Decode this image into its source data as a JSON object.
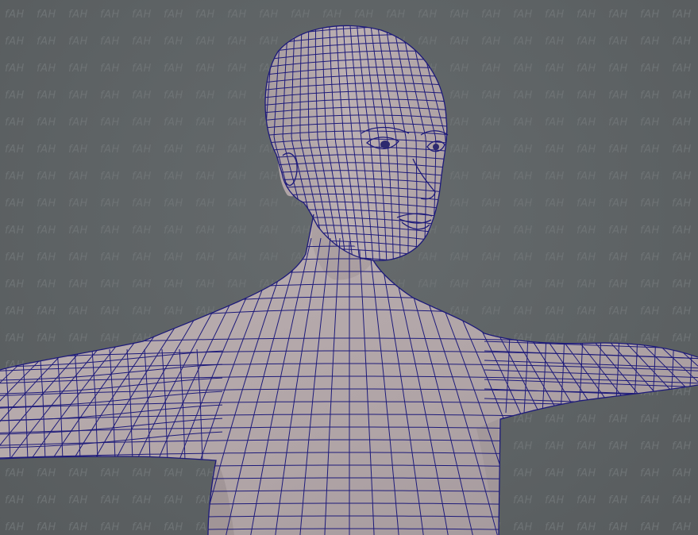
{
  "watermark": {
    "text": "fAH",
    "color": "#6e7375"
  },
  "model": {
    "skin_color": "#b2a6a8",
    "skin_shadow_color": "#9c9193",
    "wire_color": "#1d1a7a",
    "background_color": "#5f6466"
  }
}
